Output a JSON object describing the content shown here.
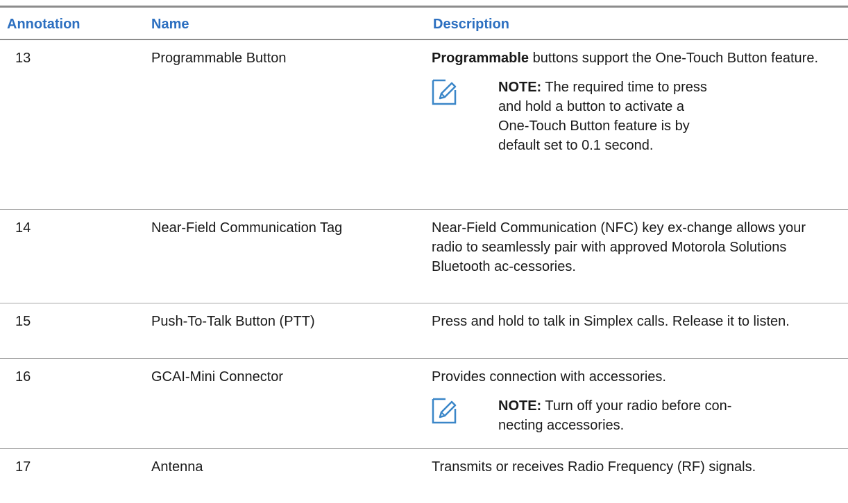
{
  "header": {
    "annotation": "Annotation",
    "name": "Name",
    "description": "Description"
  },
  "rows": [
    {
      "annotation": "13",
      "name": "Programmable Button",
      "desc_bold": "Programmable",
      "desc_rest": " buttons support the One-Touch Button feature.",
      "note_label": "NOTE:",
      "note_text": " The required time to press and hold a button to activate a One-Touch Button feature is by default set to 0.1 second."
    },
    {
      "annotation": "14",
      "name": "Near-Field Communication Tag",
      "description": "Near-Field Communication (NFC) key ex-change allows your radio to seamlessly pair with approved Motorola Solutions Bluetooth ac-cessories."
    },
    {
      "annotation": "15",
      "name": "Push-To-Talk Button (PTT)",
      "description": "Press and hold to talk in Simplex calls. Release it to listen."
    },
    {
      "annotation": "16",
      "name": "GCAI-Mini Connector",
      "description": "Provides connection with accessories.",
      "note_label": "NOTE:",
      "note_text": " Turn off your radio before con-necting accessories."
    },
    {
      "annotation": "17",
      "name": "Antenna",
      "description": "Transmits or receives Radio Frequency (RF) signals."
    }
  ],
  "colors": {
    "header_text": "#2c6fc0",
    "rule": "#8c8c8c",
    "icon": "#3a86c8"
  },
  "icons": {
    "note": "note-pencil-icon"
  }
}
